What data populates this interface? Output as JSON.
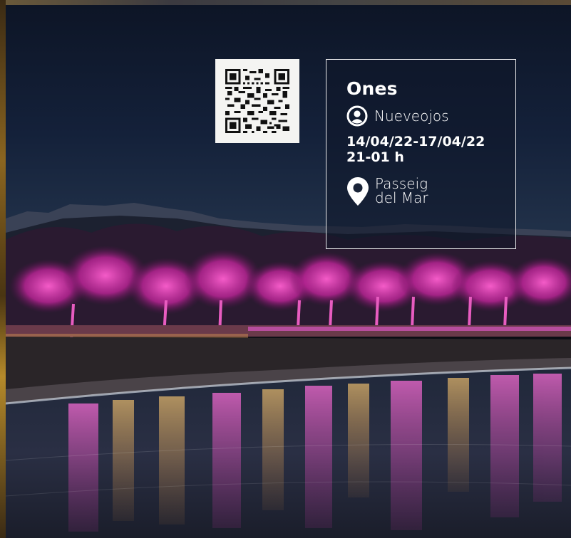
{
  "event": {
    "title": "Ones",
    "artist": "Nueveojos",
    "dates": "14/04/22-17/04/22",
    "hours": "21-01 h",
    "place_line1": "Passeig",
    "place_line2": "del Mar"
  },
  "icons": {
    "artist": "user-circle-icon",
    "place": "map-pin-icon",
    "qr": "qr-code"
  },
  "colors": {
    "info_text": "#ffffff",
    "info_border": "#e8e8ea",
    "sky_top": "#0d1526",
    "tree_pink": "#d63aa8",
    "water_pink": "#e24fb6",
    "qr_bg": "#f4f4f2"
  }
}
